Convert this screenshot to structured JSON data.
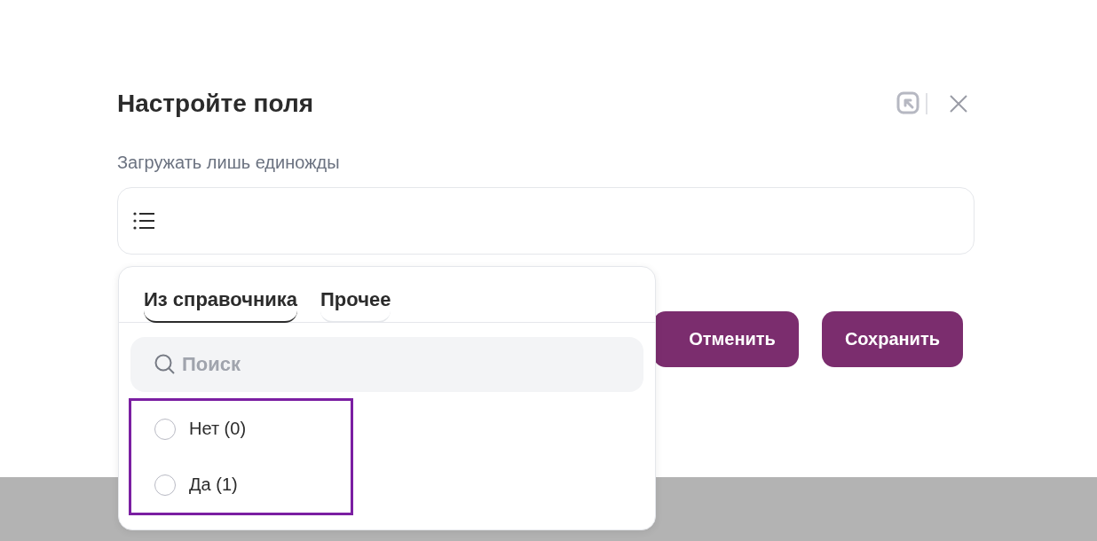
{
  "dialog": {
    "title": "Настройте поля",
    "field_label": "Загружать лишь единожды",
    "buttons": [
      {
        "label": "Отменить",
        "kind": "secondary"
      },
      {
        "label": "Сохранить",
        "kind": "primary"
      }
    ]
  },
  "dropdown": {
    "tabs": [
      {
        "label": "Из справочника",
        "selected": true
      },
      {
        "label": "Прочее",
        "selected": false
      }
    ],
    "search": {
      "placeholder": "Поиск"
    },
    "options_highlighted": true,
    "options": [
      {
        "label": "Нет (0)",
        "selected": false
      },
      {
        "label": "Да (1)",
        "selected": false
      }
    ]
  }
}
